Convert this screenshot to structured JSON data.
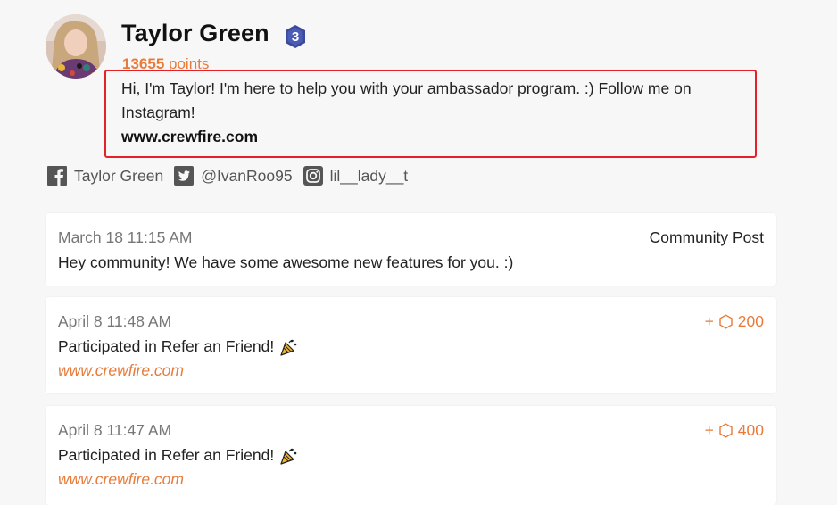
{
  "profile": {
    "name": "Taylor Green",
    "level": "3",
    "points_value": "13655",
    "points_label": "points",
    "bio": "Hi, I'm Taylor! I'm here to help you with your ambassador program. :) Follow me on Instagram!",
    "bio_link": "www.crewfire.com"
  },
  "socials": [
    {
      "icon": "facebook-icon",
      "handle": "Taylor Green"
    },
    {
      "icon": "twitter-icon",
      "handle": "@IvanRoo95"
    },
    {
      "icon": "instagram-icon",
      "handle": "lil__lady__t"
    }
  ],
  "feed": [
    {
      "date": "March 18 11:15 AM",
      "tag": "Community Post",
      "text": "Hey community! We have some awesome new features for you. :)"
    },
    {
      "date": "April 8 11:48 AM",
      "points_prefix": "+",
      "points": "200",
      "text": "Participated in Refer an Friend!",
      "link": "www.crewfire.com"
    },
    {
      "date": "April 8 11:47 AM",
      "points_prefix": "+",
      "points": "400",
      "text": "Participated in Refer an Friend!",
      "link": "www.crewfire.com"
    }
  ],
  "colors": {
    "accent": "#e87b3a",
    "highlight_border": "#e4202a",
    "background": "#f7f7f7",
    "level_badge": "#3b4a9a"
  }
}
